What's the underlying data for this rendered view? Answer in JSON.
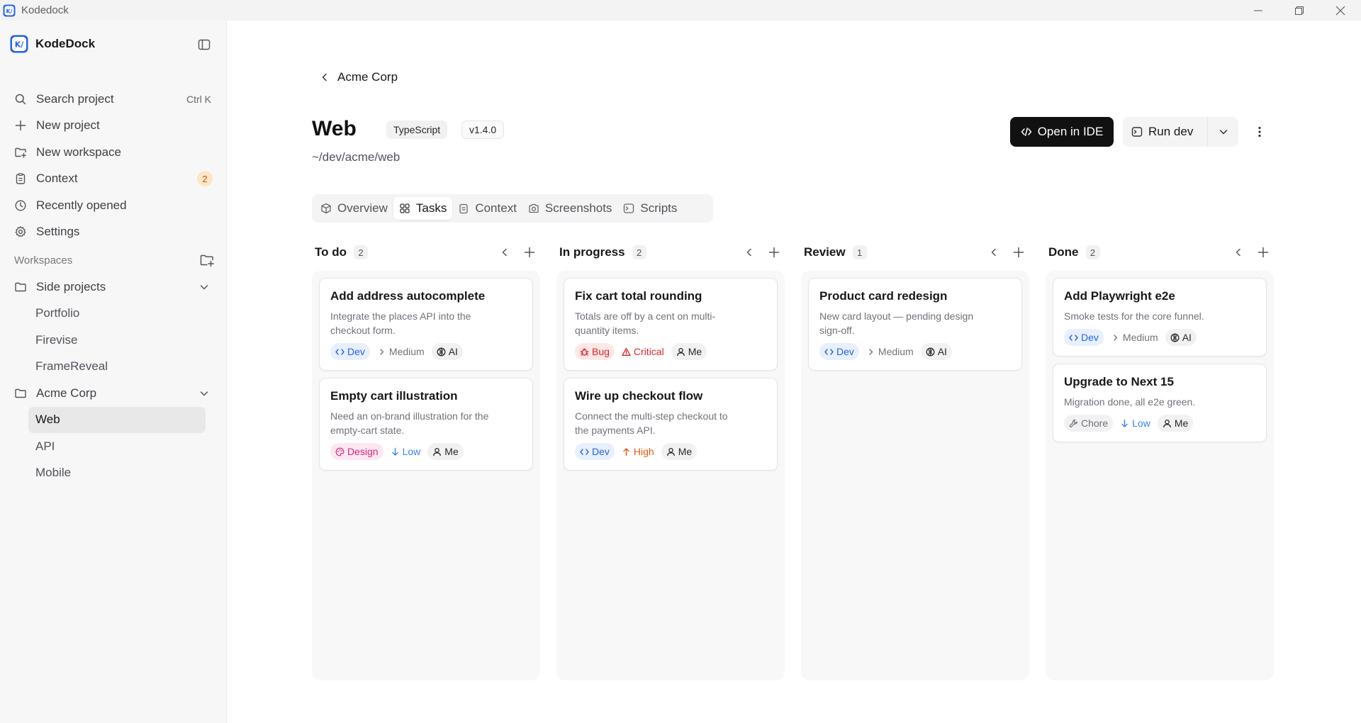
{
  "window": {
    "title": "Kodedock"
  },
  "sidebar": {
    "brand": "KodeDock",
    "nav": [
      {
        "label": "Search project",
        "icon": "search-icon",
        "shortcut": "Ctrl K"
      },
      {
        "label": "New project",
        "icon": "plus-icon"
      },
      {
        "label": "New workspace",
        "icon": "folder-plus-icon"
      },
      {
        "label": "Context",
        "icon": "clipboard-icon",
        "badge": "2"
      },
      {
        "label": "Recently opened",
        "icon": "clock-icon"
      },
      {
        "label": "Settings",
        "icon": "gear-icon"
      }
    ],
    "workspaces_label": "Workspaces",
    "workspaces": [
      {
        "name": "Side projects",
        "projects": [
          "Portfolio",
          "Firevise",
          "FrameReveal"
        ]
      },
      {
        "name": "Acme Corp",
        "projects": [
          "Web",
          "API",
          "Mobile"
        ],
        "active_project": "Web"
      }
    ]
  },
  "header": {
    "back_label": "Acme Corp",
    "project_name": "Web",
    "language_tag": "TypeScript",
    "version_tag": "v1.4.0",
    "path": "~/dev/acme/web",
    "open_ide_label": "Open in IDE",
    "run_label": "Run dev"
  },
  "tabs": [
    {
      "label": "Overview",
      "icon": "box-icon"
    },
    {
      "label": "Tasks",
      "icon": "grid-icon",
      "active": true
    },
    {
      "label": "Context",
      "icon": "clipboard-icon"
    },
    {
      "label": "Screenshots",
      "icon": "camera-icon"
    },
    {
      "label": "Scripts",
      "icon": "terminal-icon"
    }
  ],
  "columns": [
    {
      "title": "To do",
      "count": "2",
      "cards": [
        {
          "title": "Add address autocomplete",
          "desc": "Integrate the places API into the checkout form.",
          "type": "Dev",
          "priority": "Medium",
          "assignee": "AI"
        },
        {
          "title": "Empty cart illustration",
          "desc": "Need an on-brand illustration for the empty-cart state.",
          "type": "Design",
          "priority": "Low",
          "assignee": "Me"
        }
      ]
    },
    {
      "title": "In progress",
      "count": "2",
      "cards": [
        {
          "title": "Fix cart total rounding",
          "desc": "Totals are off by a cent on multi-quantity items.",
          "type": "Bug",
          "priority": "Critical",
          "assignee": "Me"
        },
        {
          "title": "Wire up checkout flow",
          "desc": "Connect the multi-step checkout to the payments API.",
          "type": "Dev",
          "priority": "High",
          "assignee": "Me"
        }
      ]
    },
    {
      "title": "Review",
      "count": "1",
      "cards": [
        {
          "title": "Product card redesign",
          "desc": "New card layout — pending design sign-off.",
          "type": "Dev",
          "priority": "Medium",
          "assignee": "AI"
        }
      ]
    },
    {
      "title": "Done",
      "count": "2",
      "cards": [
        {
          "title": "Add Playwright e2e",
          "desc": "Smoke tests for the core funnel.",
          "type": "Dev",
          "priority": "Medium",
          "assignee": "AI"
        },
        {
          "title": "Upgrade to Next 15",
          "desc": "Migration done, all e2e green.",
          "type": "Chore",
          "priority": "Low",
          "assignee": "Me"
        }
      ]
    }
  ],
  "colors": {
    "accent_dark": "#111111",
    "dev": "#2563eb",
    "bug": "#dc2626",
    "design": "#db2777",
    "high": "#ea580c",
    "low": "#3b82f6",
    "badge_bg": "#fde5c8",
    "badge_fg": "#c2560c"
  }
}
